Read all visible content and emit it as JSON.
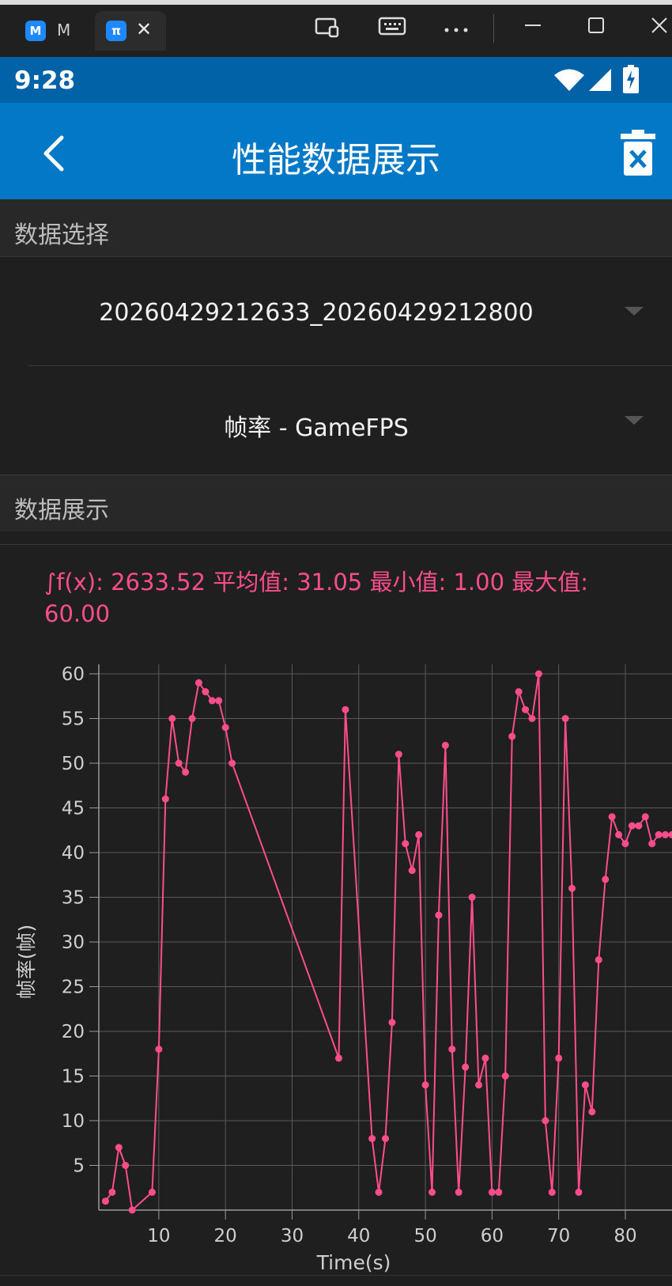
{
  "window": {
    "tabs": [
      {
        "label": "M",
        "icon": "m-app-icon"
      },
      {
        "label": "",
        "icon": "pi-app-icon"
      }
    ],
    "close_glyph": "✕"
  },
  "status_bar": {
    "time": "9:28"
  },
  "app_bar": {
    "title": "性能数据展示"
  },
  "data_select": {
    "heading": "数据选择",
    "file": "20260429212633_20260429212800",
    "metric": "帧率 - GameFPS"
  },
  "data_display": {
    "heading": "数据展示",
    "summary": "∫f(x): 2633.52 平均值: 31.05 最小值: 1.00 最大值: 60.00"
  },
  "colors": {
    "accent": "#ff4d8c",
    "app_bar": "#0278c6",
    "status_bar": "#0162a8"
  },
  "chart_data": {
    "type": "line",
    "xlabel": "Time(s)",
    "ylabel": "帧率(帧)",
    "xlim": [
      1,
      87
    ],
    "ylim": [
      0,
      60
    ],
    "x_ticks": [
      10,
      20,
      30,
      40,
      50,
      60,
      70,
      80
    ],
    "y_ticks": [
      5,
      10,
      15,
      20,
      25,
      30,
      35,
      40,
      45,
      50,
      55,
      60
    ],
    "grid": true,
    "x": [
      2,
      3,
      4,
      5,
      6,
      9,
      10,
      11,
      12,
      13,
      14,
      15,
      16,
      17,
      18,
      19,
      20,
      21,
      37,
      38,
      42,
      43,
      44,
      45,
      46,
      47,
      48,
      49,
      50,
      51,
      52,
      53,
      54,
      55,
      56,
      57,
      58,
      59,
      60,
      61,
      62,
      63,
      64,
      65,
      66,
      67,
      68,
      69,
      70,
      71,
      72,
      73,
      74,
      75,
      76,
      77,
      78,
      79,
      80,
      81,
      82,
      83,
      84,
      85,
      86,
      87
    ],
    "y": [
      1,
      2,
      7,
      5,
      0,
      2,
      18,
      46,
      55,
      50,
      49,
      55,
      59,
      58,
      57,
      57,
      54,
      50,
      17,
      56,
      8,
      2,
      8,
      21,
      51,
      41,
      38,
      42,
      14,
      2,
      33,
      52,
      18,
      2,
      16,
      35,
      14,
      17,
      2,
      2,
      15,
      53,
      58,
      56,
      55,
      60,
      10,
      2,
      17,
      55,
      36,
      2,
      14,
      11,
      28,
      37,
      44,
      42,
      41,
      43,
      43,
      44,
      41,
      42,
      42,
      42
    ]
  }
}
